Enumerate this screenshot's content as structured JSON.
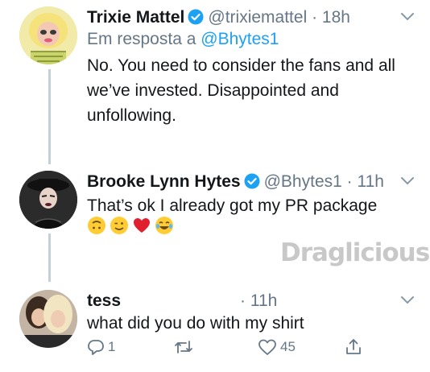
{
  "tweets": [
    {
      "name": "Trixie Mattel",
      "handle": "@trixiemattel",
      "time": "· 18h",
      "reply_prefix": "Em resposta a",
      "reply_to": "@Bhytes1",
      "lines": [
        "No. You need to consider the fans and all",
        "we’ve invested. Disappointed and",
        "unfollowing."
      ],
      "verified": true
    },
    {
      "name": "Brooke Lynn Hytes",
      "handle": "@Bhytes1",
      "time": "· 11h",
      "text": "That’s ok I already got my PR package",
      "emojis": [
        "upside-down-face",
        "winking-face",
        "red-heart",
        "tears-of-joy"
      ],
      "verified": true
    },
    {
      "name": "tess",
      "time": "· 11h",
      "text": "what did you do with my shirt",
      "actions": {
        "replies": "1",
        "likes": "45"
      }
    }
  ],
  "watermark": "Draglicious",
  "colors": {
    "link": "#1da1f2",
    "muted": "#657786",
    "thread_line": "#c4cfd6",
    "verified": "#1da1f2"
  },
  "icons": [
    "reply-icon",
    "retweet-icon",
    "like-icon",
    "share-icon",
    "chevron-down-icon",
    "verified-badge-icon"
  ]
}
